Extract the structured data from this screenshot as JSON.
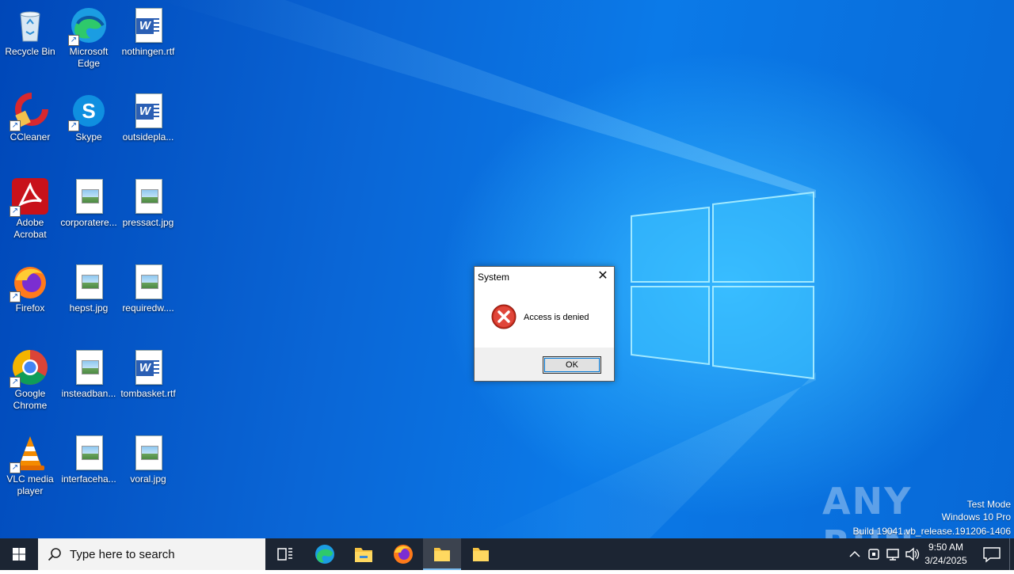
{
  "desktop": {
    "icons": [
      {
        "label": "Recycle Bin"
      },
      {
        "label": "Microsoft Edge"
      },
      {
        "label": "nothingen.rtf"
      },
      {
        "label": "CCleaner"
      },
      {
        "label": "Skype"
      },
      {
        "label": "outsidepla..."
      },
      {
        "label": "Adobe Acrobat"
      },
      {
        "label": "corporatere..."
      },
      {
        "label": "pressact.jpg"
      },
      {
        "label": "Firefox"
      },
      {
        "label": "hepst.jpg"
      },
      {
        "label": "requiredw...."
      },
      {
        "label": "Google Chrome"
      },
      {
        "label": "insteadban..."
      },
      {
        "label": "tombasket.rtf"
      },
      {
        "label": "VLC media player"
      },
      {
        "label": "interfaceha..."
      },
      {
        "label": "voral.jpg"
      }
    ]
  },
  "dialog": {
    "title": "System",
    "message": "Access is denied",
    "ok_label": "OK"
  },
  "watermark": {
    "brand": "ANY RUN",
    "line1": "Test Mode",
    "line2": "Windows 10 Pro",
    "line3": "Build 19041.vb_release.191206-1406"
  },
  "taskbar": {
    "search_placeholder": "Type here to search",
    "time": "9:50 AM",
    "date": "3/24/2025"
  },
  "colors": {
    "taskbar_bg": "#1c2533",
    "desktop_blue": "#0a66d6",
    "error_red": "#c42b1c"
  }
}
